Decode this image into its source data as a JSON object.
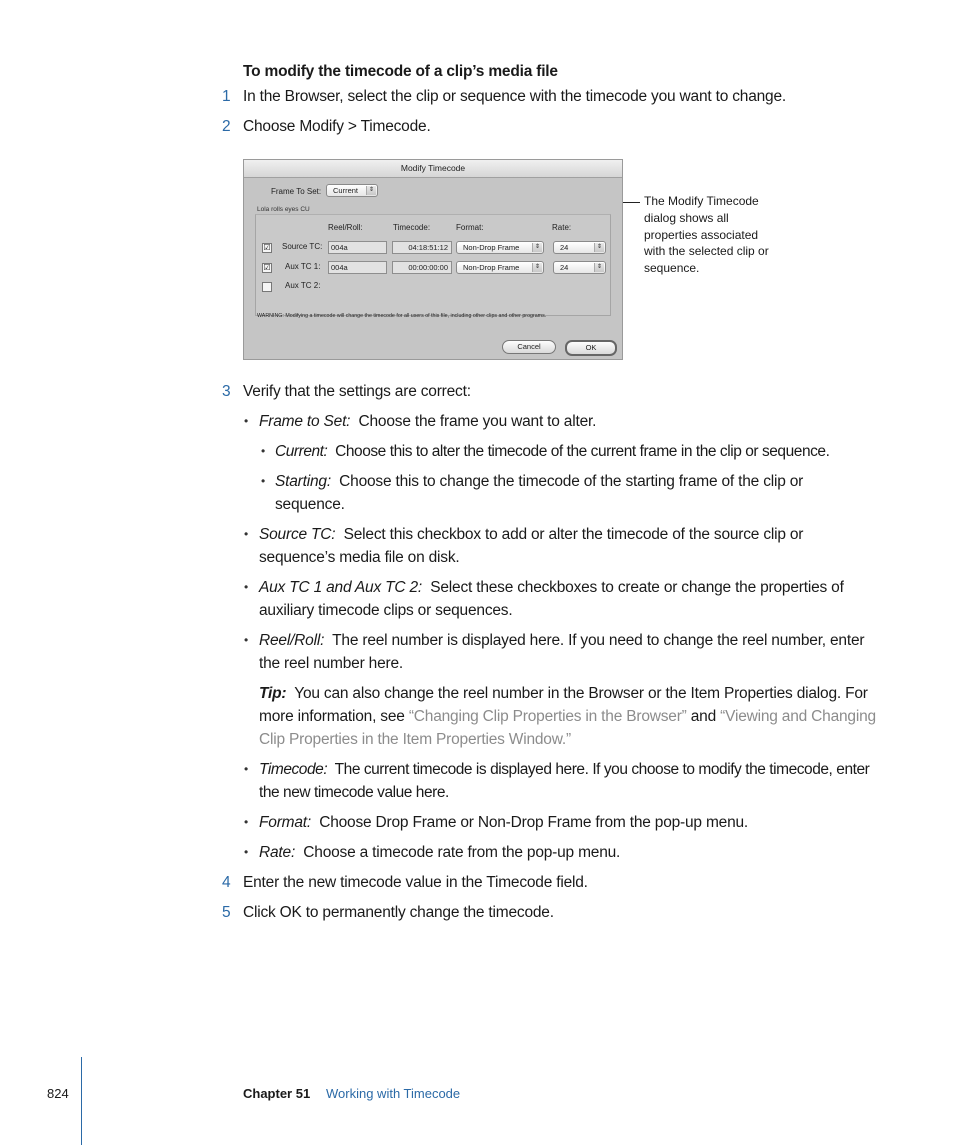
{
  "heading": "To modify the timecode of a clip’s media file",
  "steps": [
    {
      "num": "1",
      "text": "In the Browser, select the clip or sequence with the timecode you want to change."
    },
    {
      "num": "2",
      "text": "Choose Modify > Timecode."
    },
    {
      "num": "3",
      "text": "Verify that the settings are correct:"
    },
    {
      "num": "4",
      "text": "Enter the new timecode value in the Timecode field."
    },
    {
      "num": "5",
      "text": "Click OK to permanently change the timecode."
    }
  ],
  "dialog": {
    "title": "Modify Timecode",
    "frame_to_set_label": "Frame To Set:",
    "frame_to_set_value": "Current",
    "tab_label": "Lola rolls eyes CU",
    "columns": [
      "Reel/Roll:",
      "Timecode:",
      "Format:",
      "Rate:"
    ],
    "rows": [
      {
        "label": "Source TC:",
        "checked": "☑",
        "reel": "004a",
        "timecode": "04:18:51:12",
        "format": "Non-Drop Frame",
        "rate": "24"
      },
      {
        "label": "Aux TC 1:",
        "checked": "☑",
        "reel": "004a",
        "timecode": "00:00:00:00",
        "format": "Non-Drop Frame",
        "rate": "24"
      },
      {
        "label": "Aux TC 2:",
        "checked": ""
      }
    ],
    "warning": "WARNING: Modifying a timecode will change the timecode for all users of this file, including other clips and other programs.",
    "cancel_label": "Cancel",
    "ok_label": "OK",
    "popup_arrow": "⇕"
  },
  "callout": "The Modify Timecode dialog shows all properties associated with the selected clip or sequence.",
  "bullets": {
    "frame_to_set": {
      "term": "Frame to Set:",
      "text": "Choose the frame you want to alter."
    },
    "current": {
      "term": "Current:",
      "text": "Choose this to alter the timecode of the current frame in the clip or sequence."
    },
    "starting": {
      "term": "Starting:",
      "text": "Choose this to change the timecode of the starting frame of the clip or sequence."
    },
    "source_tc": {
      "term": "Source TC:",
      "text": "Select this checkbox to add or alter the timecode of the source clip or sequence’s media file on disk."
    },
    "aux_tc": {
      "term": "Aux TC 1 and Aux TC 2:",
      "text": "Select these checkboxes to create or change the properties of auxiliary timecode clips or sequences."
    },
    "reel_roll": {
      "term": "Reel/Roll:",
      "text": "The reel number is displayed here. If you need to change the reel number, enter the reel number here."
    },
    "timecode": {
      "term": "Timecode:",
      "text": "The current timecode is displayed here. If you choose to modify the timecode, enter the new timecode value here."
    },
    "format": {
      "term": "Format:",
      "text": "Choose Drop Frame or Non-Drop Frame from the pop-up menu."
    },
    "rate": {
      "term": "Rate:",
      "text": "Choose a timecode rate from the pop-up menu."
    }
  },
  "tip": {
    "label": "Tip:",
    "text1": "You can also change the reel number in the Browser or the Item Properties dialog. For more information, see ",
    "link1": "“Changing Clip Properties in the Browser”",
    "and": " and ",
    "link2": "“Viewing and Changing Clip Properties in the Item Properties Window.”"
  },
  "bullet_char": "•",
  "footer": {
    "page": "824",
    "chapter": "Chapter 51",
    "chapter_title": "Working with Timecode"
  },
  "colors": {
    "accent": "#2b6aa7",
    "link": "#8c8c8c"
  }
}
